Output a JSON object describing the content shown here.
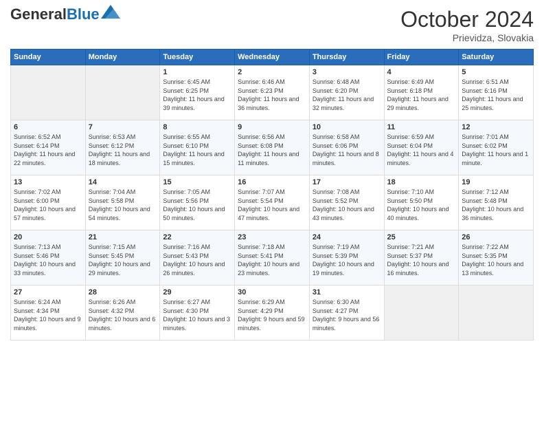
{
  "header": {
    "logo_general": "General",
    "logo_blue": "Blue",
    "month_year": "October 2024",
    "location": "Prievidza, Slovakia"
  },
  "days_of_week": [
    "Sunday",
    "Monday",
    "Tuesday",
    "Wednesday",
    "Thursday",
    "Friday",
    "Saturday"
  ],
  "weeks": [
    [
      {
        "day": "",
        "empty": true
      },
      {
        "day": "",
        "empty": true
      },
      {
        "day": "1",
        "sunrise": "6:45 AM",
        "sunset": "6:25 PM",
        "daylight": "11 hours and 39 minutes."
      },
      {
        "day": "2",
        "sunrise": "6:46 AM",
        "sunset": "6:23 PM",
        "daylight": "11 hours and 36 minutes."
      },
      {
        "day": "3",
        "sunrise": "6:48 AM",
        "sunset": "6:20 PM",
        "daylight": "11 hours and 32 minutes."
      },
      {
        "day": "4",
        "sunrise": "6:49 AM",
        "sunset": "6:18 PM",
        "daylight": "11 hours and 29 minutes."
      },
      {
        "day": "5",
        "sunrise": "6:51 AM",
        "sunset": "6:16 PM",
        "daylight": "11 hours and 25 minutes."
      }
    ],
    [
      {
        "day": "6",
        "sunrise": "6:52 AM",
        "sunset": "6:14 PM",
        "daylight": "11 hours and 22 minutes."
      },
      {
        "day": "7",
        "sunrise": "6:53 AM",
        "sunset": "6:12 PM",
        "daylight": "11 hours and 18 minutes."
      },
      {
        "day": "8",
        "sunrise": "6:55 AM",
        "sunset": "6:10 PM",
        "daylight": "11 hours and 15 minutes."
      },
      {
        "day": "9",
        "sunrise": "6:56 AM",
        "sunset": "6:08 PM",
        "daylight": "11 hours and 11 minutes."
      },
      {
        "day": "10",
        "sunrise": "6:58 AM",
        "sunset": "6:06 PM",
        "daylight": "11 hours and 8 minutes."
      },
      {
        "day": "11",
        "sunrise": "6:59 AM",
        "sunset": "6:04 PM",
        "daylight": "11 hours and 4 minutes."
      },
      {
        "day": "12",
        "sunrise": "7:01 AM",
        "sunset": "6:02 PM",
        "daylight": "11 hours and 1 minute."
      }
    ],
    [
      {
        "day": "13",
        "sunrise": "7:02 AM",
        "sunset": "6:00 PM",
        "daylight": "10 hours and 57 minutes."
      },
      {
        "day": "14",
        "sunrise": "7:04 AM",
        "sunset": "5:58 PM",
        "daylight": "10 hours and 54 minutes."
      },
      {
        "day": "15",
        "sunrise": "7:05 AM",
        "sunset": "5:56 PM",
        "daylight": "10 hours and 50 minutes."
      },
      {
        "day": "16",
        "sunrise": "7:07 AM",
        "sunset": "5:54 PM",
        "daylight": "10 hours and 47 minutes."
      },
      {
        "day": "17",
        "sunrise": "7:08 AM",
        "sunset": "5:52 PM",
        "daylight": "10 hours and 43 minutes."
      },
      {
        "day": "18",
        "sunrise": "7:10 AM",
        "sunset": "5:50 PM",
        "daylight": "10 hours and 40 minutes."
      },
      {
        "day": "19",
        "sunrise": "7:12 AM",
        "sunset": "5:48 PM",
        "daylight": "10 hours and 36 minutes."
      }
    ],
    [
      {
        "day": "20",
        "sunrise": "7:13 AM",
        "sunset": "5:46 PM",
        "daylight": "10 hours and 33 minutes."
      },
      {
        "day": "21",
        "sunrise": "7:15 AM",
        "sunset": "5:45 PM",
        "daylight": "10 hours and 29 minutes."
      },
      {
        "day": "22",
        "sunrise": "7:16 AM",
        "sunset": "5:43 PM",
        "daylight": "10 hours and 26 minutes."
      },
      {
        "day": "23",
        "sunrise": "7:18 AM",
        "sunset": "5:41 PM",
        "daylight": "10 hours and 23 minutes."
      },
      {
        "day": "24",
        "sunrise": "7:19 AM",
        "sunset": "5:39 PM",
        "daylight": "10 hours and 19 minutes."
      },
      {
        "day": "25",
        "sunrise": "7:21 AM",
        "sunset": "5:37 PM",
        "daylight": "10 hours and 16 minutes."
      },
      {
        "day": "26",
        "sunrise": "7:22 AM",
        "sunset": "5:35 PM",
        "daylight": "10 hours and 13 minutes."
      }
    ],
    [
      {
        "day": "27",
        "sunrise": "6:24 AM",
        "sunset": "4:34 PM",
        "daylight": "10 hours and 9 minutes."
      },
      {
        "day": "28",
        "sunrise": "6:26 AM",
        "sunset": "4:32 PM",
        "daylight": "10 hours and 6 minutes."
      },
      {
        "day": "29",
        "sunrise": "6:27 AM",
        "sunset": "4:30 PM",
        "daylight": "10 hours and 3 minutes."
      },
      {
        "day": "30",
        "sunrise": "6:29 AM",
        "sunset": "4:29 PM",
        "daylight": "9 hours and 59 minutes."
      },
      {
        "day": "31",
        "sunrise": "6:30 AM",
        "sunset": "4:27 PM",
        "daylight": "9 hours and 56 minutes."
      },
      {
        "day": "",
        "empty": true
      },
      {
        "day": "",
        "empty": true
      }
    ]
  ],
  "labels": {
    "sunrise": "Sunrise:",
    "sunset": "Sunset:",
    "daylight": "Daylight:"
  }
}
